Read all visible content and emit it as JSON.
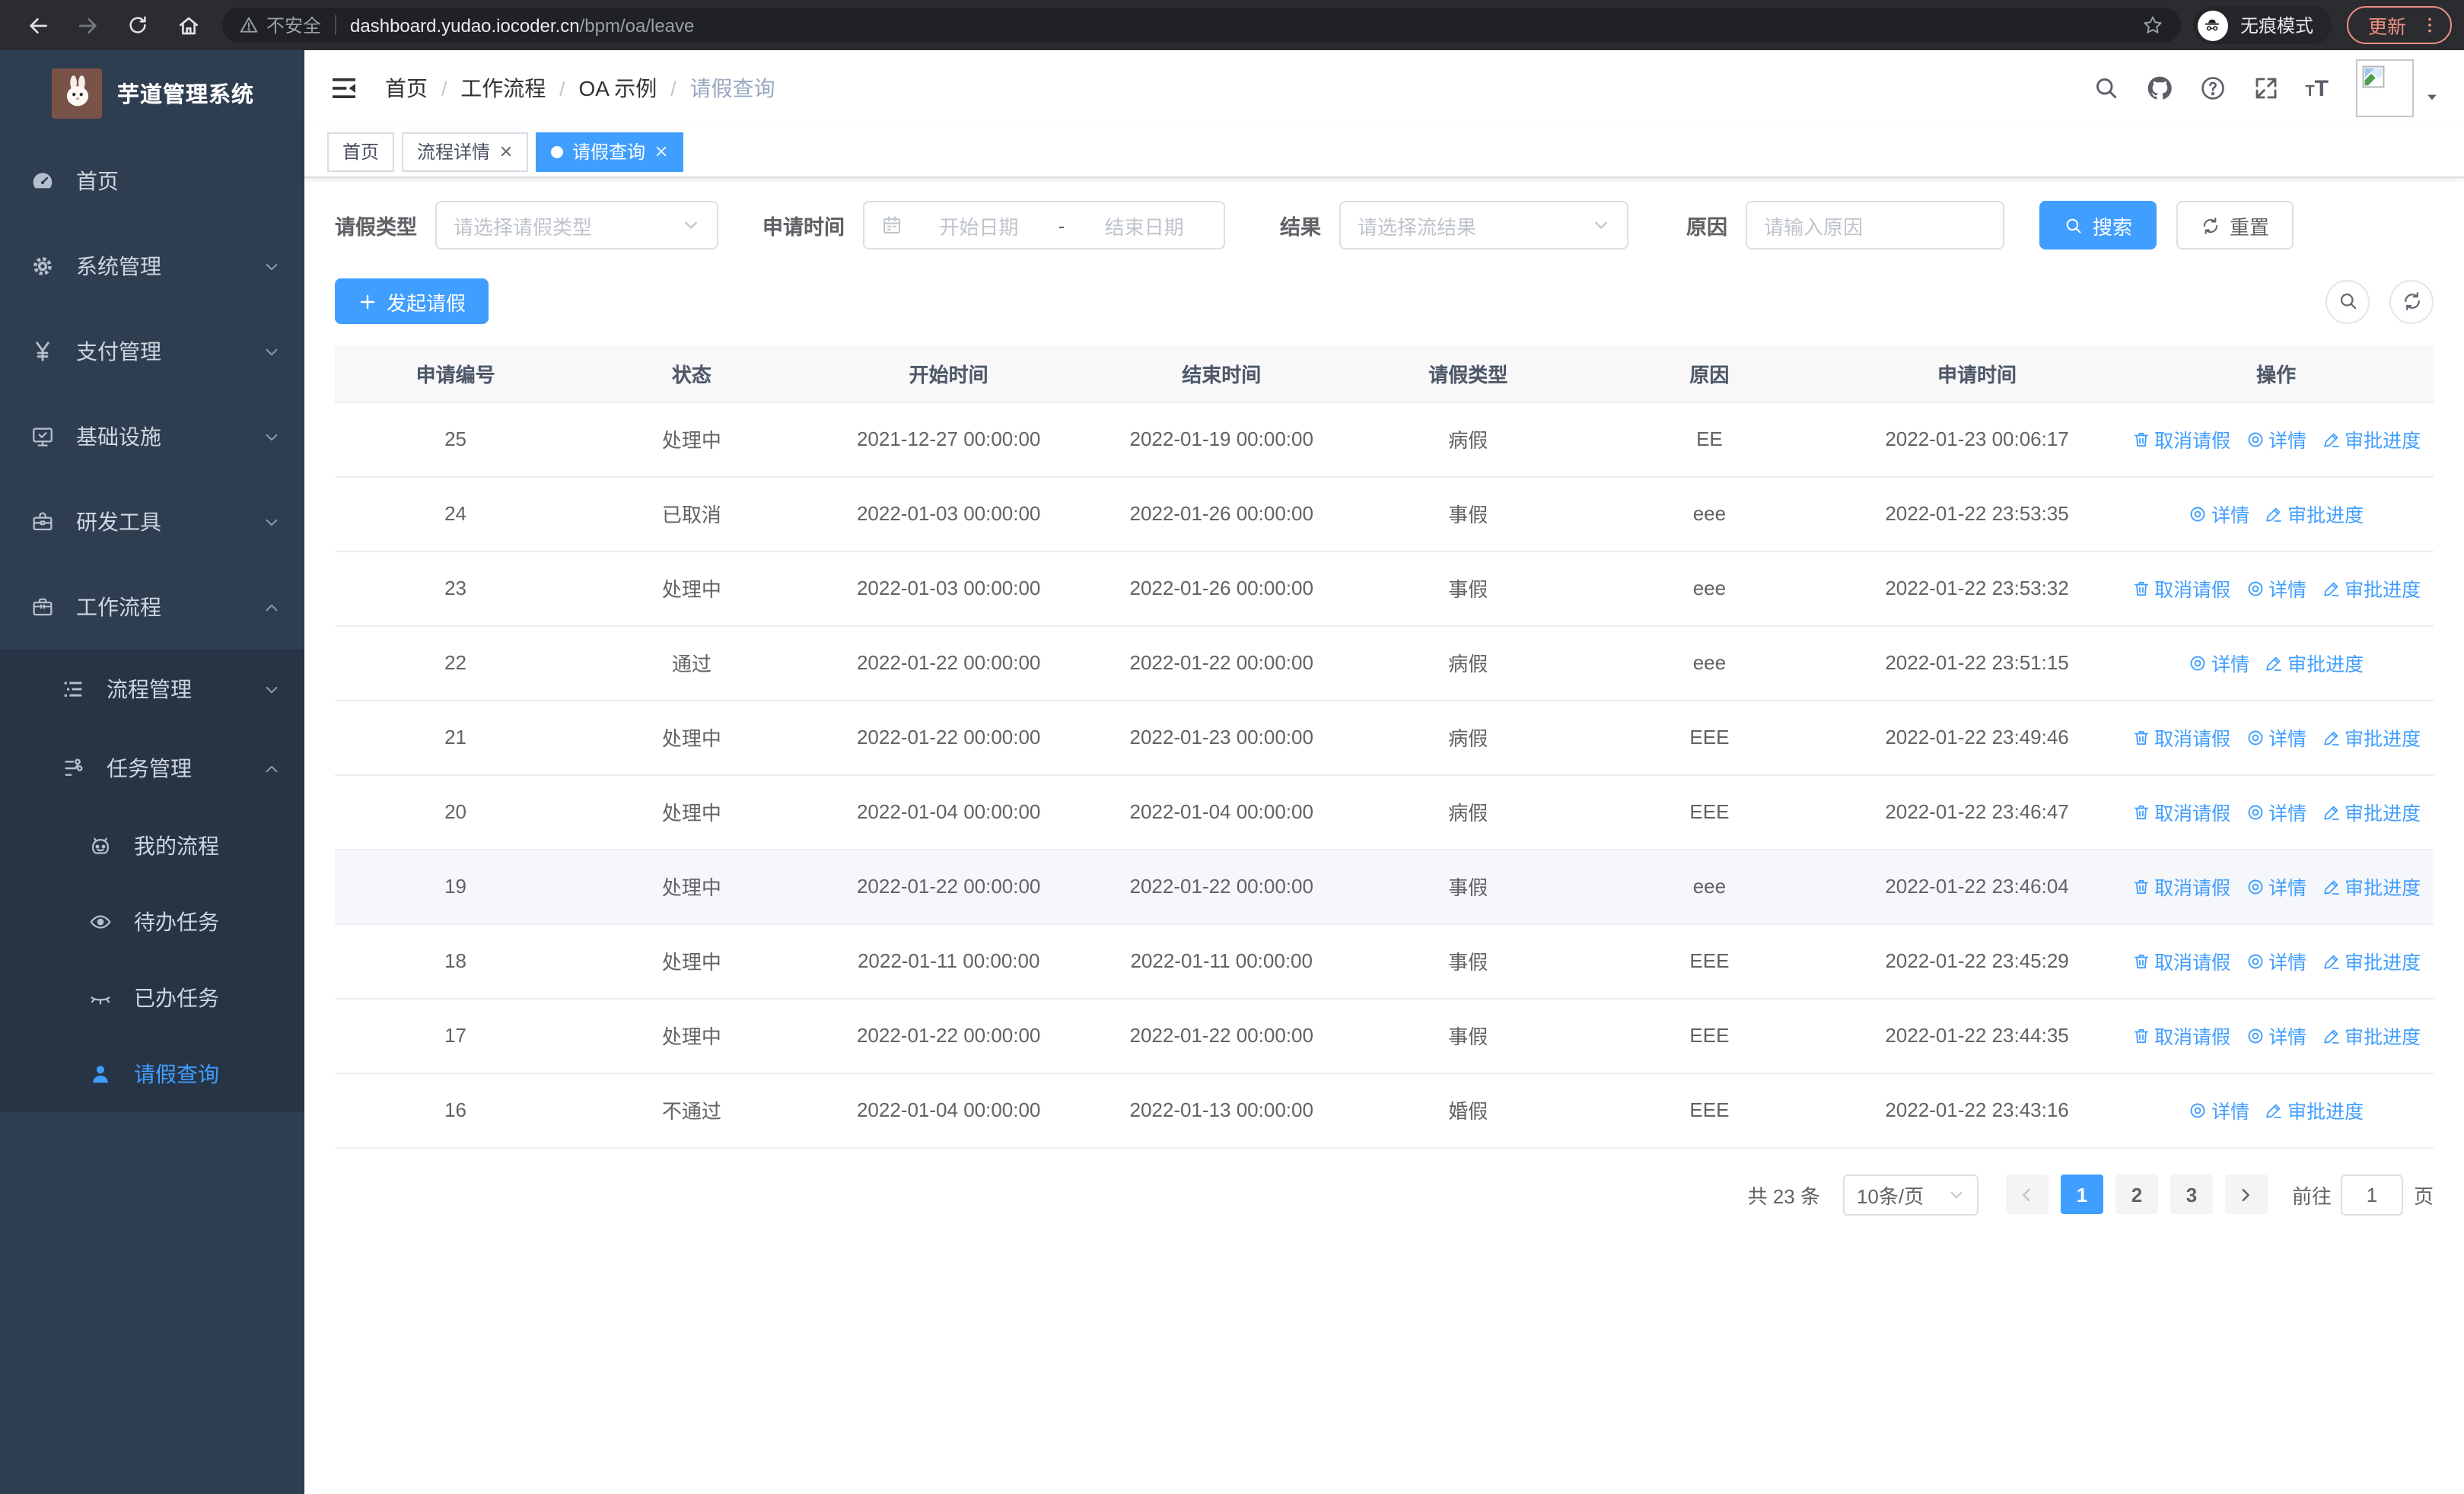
{
  "colors": {
    "accent": "#409eff",
    "sidebar_bg": "#2f3d50",
    "submenu_bg": "#273445",
    "update_accent": "#ee8f85",
    "table_header_bg": "#f8f8f9",
    "row_highlight": "#f5f7fa"
  },
  "browser": {
    "security_label": "不安全",
    "url_domain": "dashboard.yudao.iocoder.cn",
    "url_path": "/bpm/oa/leave",
    "incognito_label": "无痕模式",
    "update_label": "更新"
  },
  "sidebar": {
    "title": "芋道管理系统",
    "menu": [
      {
        "key": "home",
        "label": "首页",
        "icon": "dashboard-icon"
      },
      {
        "key": "system",
        "label": "系统管理",
        "icon": "gear-icon",
        "chevron": "down"
      },
      {
        "key": "payment",
        "label": "支付管理",
        "icon": "yen-icon",
        "chevron": "down"
      },
      {
        "key": "infra",
        "label": "基础设施",
        "icon": "monitor-icon",
        "chevron": "down"
      },
      {
        "key": "devtools",
        "label": "研发工具",
        "icon": "toolbox-icon",
        "chevron": "down"
      },
      {
        "key": "workflow",
        "label": "工作流程",
        "icon": "briefcase-icon",
        "chevron": "up",
        "expanded": true,
        "children": [
          {
            "key": "process-mgmt",
            "label": "流程管理",
            "icon": "tree-icon",
            "chevron": "down"
          },
          {
            "key": "task-mgmt",
            "label": "任务管理",
            "icon": "flow-icon",
            "chevron": "up",
            "expanded": true,
            "children": [
              {
                "key": "my-process",
                "label": "我的流程",
                "icon": "robot-icon"
              },
              {
                "key": "todo-tasks",
                "label": "待办任务",
                "icon": "eye-open-icon"
              },
              {
                "key": "done-tasks",
                "label": "已办任务",
                "icon": "eye-closed-icon"
              },
              {
                "key": "leave-query",
                "label": "请假查询",
                "icon": "person-icon",
                "active": true
              }
            ]
          }
        ]
      }
    ]
  },
  "navbar": {
    "breadcrumb": [
      "首页",
      "工作流程",
      "OA 示例",
      "请假查询"
    ]
  },
  "tabs": [
    {
      "key": "home",
      "label": "首页",
      "closable": false,
      "active": false
    },
    {
      "key": "process-detail",
      "label": "流程详情",
      "closable": true,
      "active": false
    },
    {
      "key": "leave-query",
      "label": "请假查询",
      "closable": true,
      "active": true
    }
  ],
  "filters": {
    "leave_type": {
      "label": "请假类型",
      "placeholder": "请选择请假类型"
    },
    "apply_time": {
      "label": "申请时间",
      "start_placeholder": "开始日期",
      "separator": "-",
      "end_placeholder": "结束日期"
    },
    "result": {
      "label": "结果",
      "placeholder": "请选择流结果"
    },
    "reason": {
      "label": "原因",
      "placeholder": "请输入原因"
    },
    "search_label": "搜索",
    "reset_label": "重置"
  },
  "actions_bar": {
    "create_label": "发起请假"
  },
  "table": {
    "columns": [
      "申请编号",
      "状态",
      "开始时间",
      "结束时间",
      "请假类型",
      "原因",
      "申请时间",
      "操作"
    ],
    "col_widths": [
      "11.5%",
      "11%",
      "13.5%",
      "12.5%",
      "11%",
      "12%",
      "13.5%",
      "15%"
    ],
    "action_labels": {
      "cancel": "取消请假",
      "detail": "详情",
      "progress": "审批进度"
    },
    "rows": [
      {
        "id": "25",
        "status": "处理中",
        "start": "2021-12-27 00:00:00",
        "end": "2022-01-19 00:00:00",
        "type": "病假",
        "reason": "EE",
        "apply": "2022-01-23 00:06:17",
        "actions": [
          "cancel",
          "detail",
          "progress"
        ],
        "highlight": false
      },
      {
        "id": "24",
        "status": "已取消",
        "start": "2022-01-03 00:00:00",
        "end": "2022-01-26 00:00:00",
        "type": "事假",
        "reason": "eee",
        "apply": "2022-01-22 23:53:35",
        "actions": [
          "detail",
          "progress"
        ],
        "highlight": false
      },
      {
        "id": "23",
        "status": "处理中",
        "start": "2022-01-03 00:00:00",
        "end": "2022-01-26 00:00:00",
        "type": "事假",
        "reason": "eee",
        "apply": "2022-01-22 23:53:32",
        "actions": [
          "cancel",
          "detail",
          "progress"
        ],
        "highlight": false
      },
      {
        "id": "22",
        "status": "通过",
        "start": "2022-01-22 00:00:00",
        "end": "2022-01-22 00:00:00",
        "type": "病假",
        "reason": "eee",
        "apply": "2022-01-22 23:51:15",
        "actions": [
          "detail",
          "progress"
        ],
        "highlight": false
      },
      {
        "id": "21",
        "status": "处理中",
        "start": "2022-01-22 00:00:00",
        "end": "2022-01-23 00:00:00",
        "type": "病假",
        "reason": "EEE",
        "apply": "2022-01-22 23:49:46",
        "actions": [
          "cancel",
          "detail",
          "progress"
        ],
        "highlight": false
      },
      {
        "id": "20",
        "status": "处理中",
        "start": "2022-01-04 00:00:00",
        "end": "2022-01-04 00:00:00",
        "type": "病假",
        "reason": "EEE",
        "apply": "2022-01-22 23:46:47",
        "actions": [
          "cancel",
          "detail",
          "progress"
        ],
        "highlight": false
      },
      {
        "id": "19",
        "status": "处理中",
        "start": "2022-01-22 00:00:00",
        "end": "2022-01-22 00:00:00",
        "type": "事假",
        "reason": "eee",
        "apply": "2022-01-22 23:46:04",
        "actions": [
          "cancel",
          "detail",
          "progress"
        ],
        "highlight": true
      },
      {
        "id": "18",
        "status": "处理中",
        "start": "2022-01-11 00:00:00",
        "end": "2022-01-11 00:00:00",
        "type": "事假",
        "reason": "EEE",
        "apply": "2022-01-22 23:45:29",
        "actions": [
          "cancel",
          "detail",
          "progress"
        ],
        "highlight": false
      },
      {
        "id": "17",
        "status": "处理中",
        "start": "2022-01-22 00:00:00",
        "end": "2022-01-22 00:00:00",
        "type": "事假",
        "reason": "EEE",
        "apply": "2022-01-22 23:44:35",
        "actions": [
          "cancel",
          "detail",
          "progress"
        ],
        "highlight": false
      },
      {
        "id": "16",
        "status": "不通过",
        "start": "2022-01-04 00:00:00",
        "end": "2022-01-13 00:00:00",
        "type": "婚假",
        "reason": "EEE",
        "apply": "2022-01-22 23:43:16",
        "actions": [
          "detail",
          "progress"
        ],
        "highlight": false
      }
    ]
  },
  "pagination": {
    "total": "共 23 条",
    "page_size": "10条/页",
    "pages": [
      "1",
      "2",
      "3"
    ],
    "current": "1",
    "goto_label": "前往",
    "goto_value": "1",
    "unit_label": "页"
  }
}
